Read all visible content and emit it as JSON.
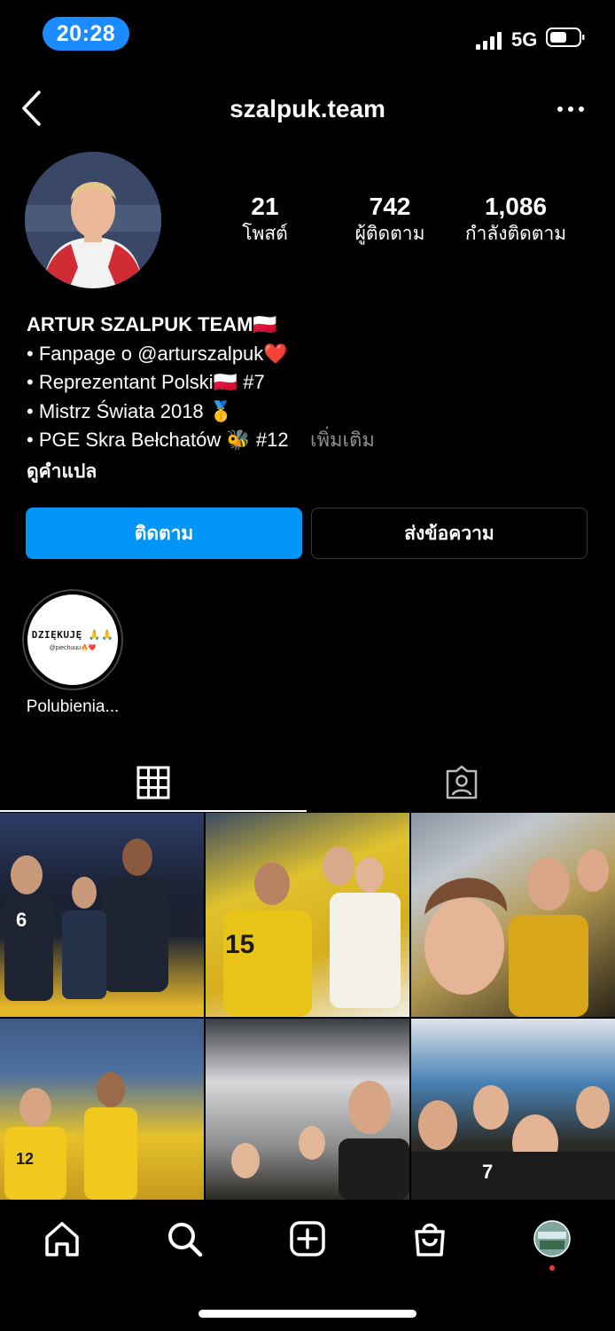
{
  "status_bar": {
    "time": "20:28",
    "network": "5G"
  },
  "header": {
    "username": "szalpuk.team"
  },
  "stats": [
    {
      "value": "21",
      "label": "โพสต์"
    },
    {
      "value": "742",
      "label": "ผู้ติดตาม"
    },
    {
      "value": "1,086",
      "label": "กำลังติดตาม"
    }
  ],
  "bio": {
    "title": "ARTUR SZALPUK TEAM🇵🇱",
    "lines": [
      "• Fanpage o @arturszalpuk❤️",
      "• Reprezentant Polski🇵🇱 #7",
      "• Mistrz Świata 2018 🥇",
      "• PGE Skra Bełchatów 🐝 #12"
    ],
    "more": "เพิ่มเติม",
    "see_translation": "ดูคำแปล"
  },
  "actions": {
    "follow": "ติดตาม",
    "message": "ส่งข้อความ"
  },
  "highlights": [
    {
      "cover_text": "DZIĘKUJĘ 🙏🙏",
      "cover_sub": "@piechuuu🔥❤️",
      "label": "Polubienia..."
    }
  ],
  "posts": [
    {
      "jersey": "6"
    },
    {
      "jersey": "15"
    },
    {
      "jersey": ""
    },
    {
      "jersey": "12"
    },
    {
      "jersey": ""
    },
    {
      "jersey": "7"
    }
  ],
  "colors": {
    "follow_button": "#0095f6",
    "time_pill": "#1a8cff",
    "notification_dot": "#ff3040"
  }
}
